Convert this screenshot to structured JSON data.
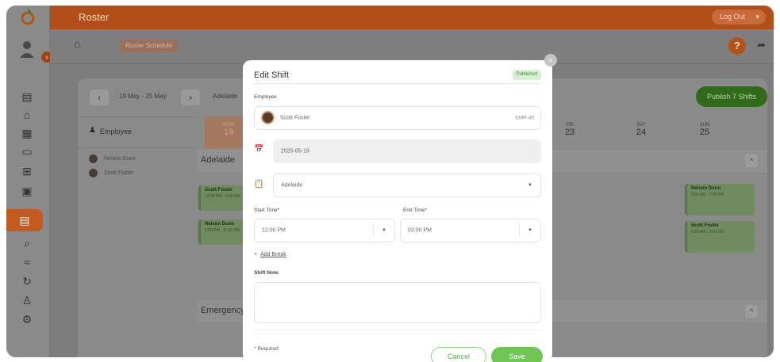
{
  "app": {
    "title": "Roster",
    "logout_label": "Log Out",
    "breadcrumb": "Roster Schedule",
    "help_label": "?"
  },
  "sidebar": {
    "badge": "›",
    "icons": [
      "timesheet-icon",
      "briefcase-icon",
      "report-icon",
      "wallet-icon",
      "org-icon",
      "calendar-icon",
      "roster-icon",
      "search-icon",
      "handshake-icon",
      "history-icon",
      "user-icon",
      "settings-icon"
    ]
  },
  "toolbar": {
    "prev": "‹",
    "next": "›",
    "date_range": "19 May - 25 May",
    "region": "Adelaide",
    "publish_label": "Publish 7 Shifts"
  },
  "grid": {
    "employee_header": "Employee",
    "employees": [
      {
        "name": "Nelson Dunn"
      },
      {
        "name": "Scott Foster"
      }
    ],
    "days": [
      {
        "name": "MON",
        "date": "19"
      },
      {
        "name": "FRI",
        "date": "23"
      },
      {
        "name": "SAT",
        "date": "24"
      },
      {
        "name": "SUN",
        "date": "25"
      }
    ],
    "sections": [
      "Adelaide",
      "Emergency"
    ],
    "cards": [
      {
        "name": "Scott Foster",
        "time": "12:00 PM - 3:00 PM"
      },
      {
        "name": "Nelson Dunn",
        "time": "1:00 PM - 11:00 PM"
      },
      {
        "name": "Nelson Dunn",
        "time": "9:00 AM - 7:00 PM"
      },
      {
        "name": "Scott Foster",
        "time": "9:00 AM - 3:00 PM"
      }
    ]
  },
  "modal": {
    "title": "Edit Shift",
    "status": "Published",
    "employee_label": "Employee",
    "employee_name": "Scott Foster",
    "employee_id": "EMP-45",
    "date": "2025-05-19",
    "location": "Adelaide",
    "start_label": "Start Time*",
    "start_value": "12:00 PM",
    "end_label": "End Time*",
    "end_value": "03:00 PM",
    "add_break": "Add Break",
    "add_break_icon": "+",
    "note_label": "Shift Note",
    "note_value": "",
    "required_note": "* Required",
    "cancel_label": "Cancel",
    "save_label": "Save",
    "close": "×"
  },
  "colors": {
    "brand_orange": "#e87722",
    "accent_green": "#6fc655",
    "published_bg": "#d9efd3"
  }
}
